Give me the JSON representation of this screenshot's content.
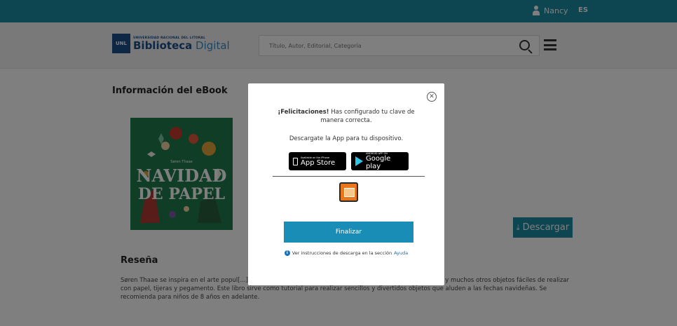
{
  "topbar": {
    "user_name": "Nancy",
    "language": "ES"
  },
  "header": {
    "logo_box": "UNL",
    "logo_top": "UNIVERSIDAD NACIONAL DEL LITORAL",
    "logo_bold": "Biblioteca",
    "logo_light": "Digital",
    "search_placeholder": "Título, Autor, Editorial, Categoría"
  },
  "ebook": {
    "page_title": "Información del eBook",
    "cover_author": "Søren Thaae",
    "cover_title_1": "NAVIDAD",
    "cover_title_2": "DE PAPEL",
    "download_label": "Descargar",
    "review_heading": "Reseña",
    "review_text": "Søren Thaae se inspira en el arte popul[...]miento, canastitas para la colación, máscaras para las pastorelas y muchos otros objetos fáciles de realizar con papel, tijeras y pegamento. Este libro sirve como tutorial para realizar sencillos y divertidos objetos que aluden a las fechas navideñas. Se recomienda para niños de 8 años en adelante."
  },
  "modal": {
    "close_symbol": "✕",
    "congrats_bold": "¡Felicitaciones!",
    "congrats_text": " Has configurado tu clave de manera correcta.",
    "download_app_text": "Descargate la App para tu dispositivo.",
    "app_store_small": "Available on the iPhone",
    "app_store_big": "App Store",
    "google_play_small": "ANDROID APP ON",
    "google_play_big": "Google play",
    "finalizar_label": "Finalizar",
    "help_text": "Ver instrucciones de descarga en la sección",
    "help_link": "Ayuda"
  }
}
